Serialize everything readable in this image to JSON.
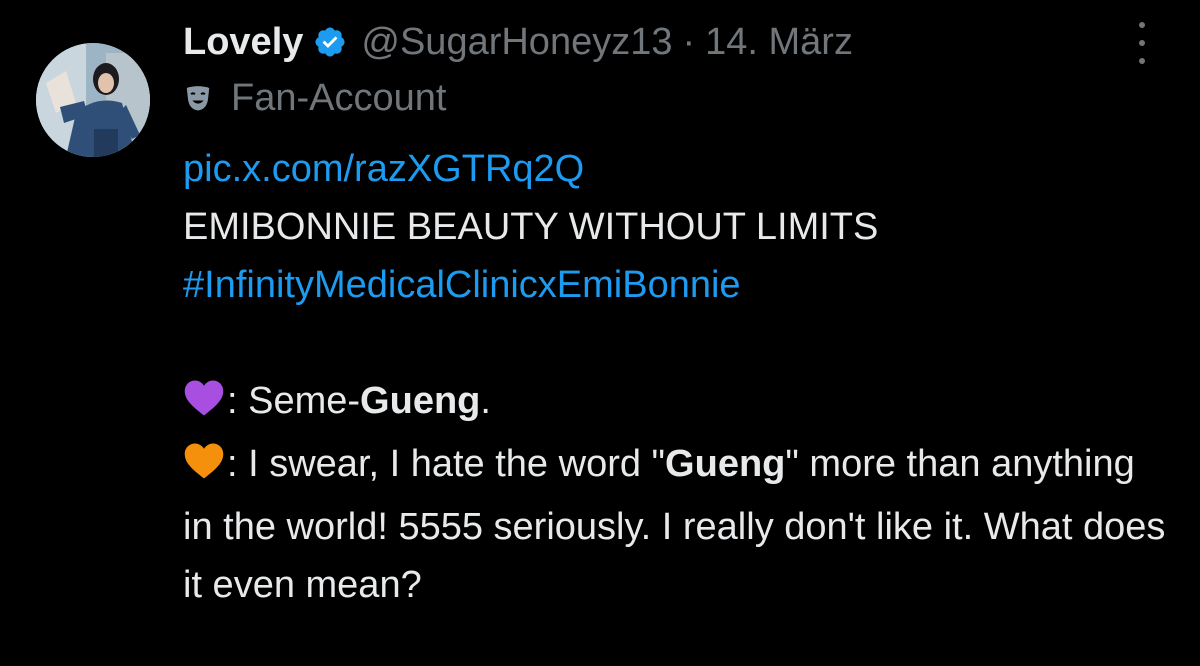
{
  "author": {
    "display_name": "Lovely",
    "handle": "@SugarHoneyz13",
    "separator": "·",
    "date": "14. März",
    "label": "Fan-Account"
  },
  "icons": {
    "verified": "verified-badge-icon",
    "label": "theater-mask-icon",
    "more": "more-options-icon",
    "purple_heart": "purple-heart-icon",
    "orange_heart": "orange-heart-icon"
  },
  "colors": {
    "background": "#000000",
    "text": "#e7e9ea",
    "secondary": "#71767b",
    "link": "#1d9bf0",
    "purple_heart": "#a84ee0",
    "orange_heart": "#f4900c"
  },
  "tweet": {
    "pic_link": "pic.x.com/razXGTRq2Q",
    "headline": "EMIBONNIE BEAUTY WITHOUT LIMITS",
    "hashtag": "#InfinityMedicalClinicxEmiBonnie",
    "line1_prefix": ": Seme-",
    "line1_bold": "Gueng",
    "line1_suffix": ".",
    "line2_prefix": ": I swear, I hate the word \"",
    "line2_bold": "Gueng",
    "line2_suffix": "\" more than anything in the world! 5555 seriously. I really don't like it. What does it even mean?"
  }
}
